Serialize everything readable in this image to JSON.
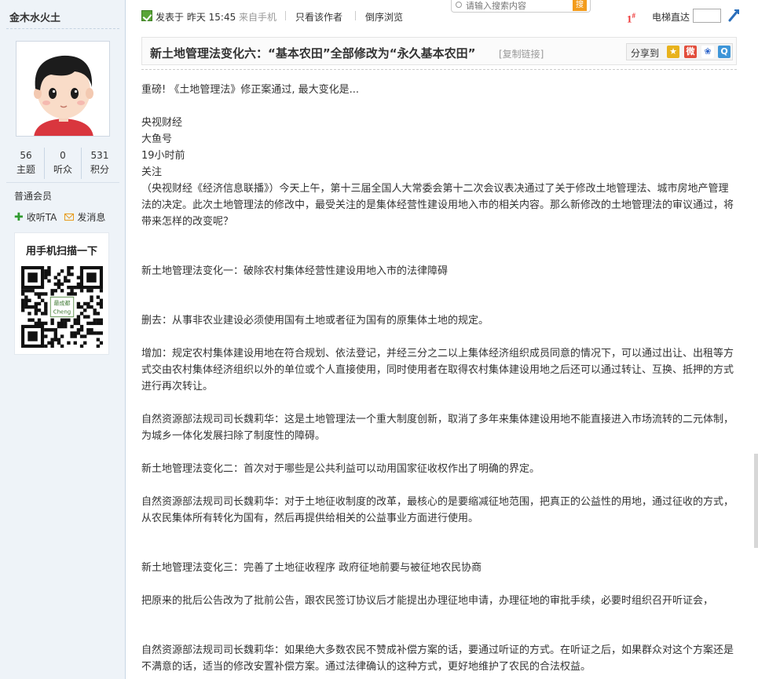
{
  "user": {
    "name": "金木水火土",
    "stats": [
      {
        "value": "56",
        "label": "主题"
      },
      {
        "value": "0",
        "label": "听众"
      },
      {
        "value": "531",
        "label": "积分"
      }
    ],
    "group": "普通会员",
    "follow_label": "收听TA",
    "message_label": "发消息",
    "qr_title": "用手机扫描一下",
    "qr_logo_text": "最成都 Cheng"
  },
  "topbar": {
    "posted_prefix": "发表于 昨天 15:45",
    "source": "来自手机",
    "author_only": "只看该作者",
    "reverse": "倒序浏览",
    "search_placeholder": "请输入搜索内容",
    "search_button": "搜",
    "floor": "1",
    "floor_mark": "#",
    "jump_label": "电梯直达",
    "jump_value": ""
  },
  "post": {
    "title": "新土地管理法变化六：“基本农田”全部修改为“永久基本农田”",
    "copy_link": "[复制链接]",
    "share_label": "分享到",
    "share_icons": [
      "qzone-icon",
      "weibo-icon",
      "baidu-icon",
      "qq-icon"
    ]
  },
  "content": [
    "重磅! 《土地管理法》修正案通过, 最大变化是...",
    "央视财经",
    "大鱼号",
    "19小时前",
    "关注",
    "（央视财经《经济信息联播》）今天上午，第十三届全国人大常委会第十二次会议表决通过了关于修改土地管理法、城市房地产管理法的决定。此次土地管理法的修改中，最受关注的是集体经营性建设用地入市的相关内容。那么新修改的土地管理法的审议通过，将带来怎样的改变呢？",
    "新土地管理法变化一：破除农村集体经营性建设用地入市的法律障碍",
    "删去：从事非农业建设必须使用国有土地或者征为国有的原集体土地的规定。",
    "增加：规定农村集体建设用地在符合规划、依法登记，并经三分之二以上集体经济组织成员同意的情况下，可以通过出让、出租等方式交由农村集体经济组织以外的单位或个人直接使用，同时使用者在取得农村集体建设用地之后还可以通过转让、互换、抵押的方式进行再次转让。",
    "自然资源部法规司司长魏莉华：这是土地管理法一个重大制度创新，取消了多年来集体建设用地不能直接进入市场流转的二元体制，为城乡一体化发展扫除了制度性的障碍。",
    "新土地管理法变化二：首次对于哪些是公共利益可以动用国家征收权作出了明确的界定。",
    "自然资源部法规司司长魏莉华：对于土地征收制度的改革，最核心的是要缩减征地范围，把真正的公益性的用地，通过征收的方式，从农民集体所有转化为国有，然后再提供给相关的公益事业方面进行使用。",
    "新土地管理法变化三：完善了土地征收程序 政府征地前要与被征地农民协商",
    "把原来的批后公告改为了批前公告，跟农民签订协议后才能提出办理征地申请，办理征地的审批手续，必要时组织召开听证会，",
    "自然资源部法规司司长魏莉华：如果绝大多数农民不赞成补偿方案的话，要通过听证的方式。在听证之后，如果群众对这个方案还是不满意的话，适当的修改安置补偿方案。通过法律确认的这种方式，更好地维护了农民的合法权益。"
  ],
  "colors": {
    "sidebar_bg": "#eef3f8",
    "floor_red": "#ee3333",
    "follow_green": "#2f9a2f",
    "message_orange": "#e89b1c"
  }
}
